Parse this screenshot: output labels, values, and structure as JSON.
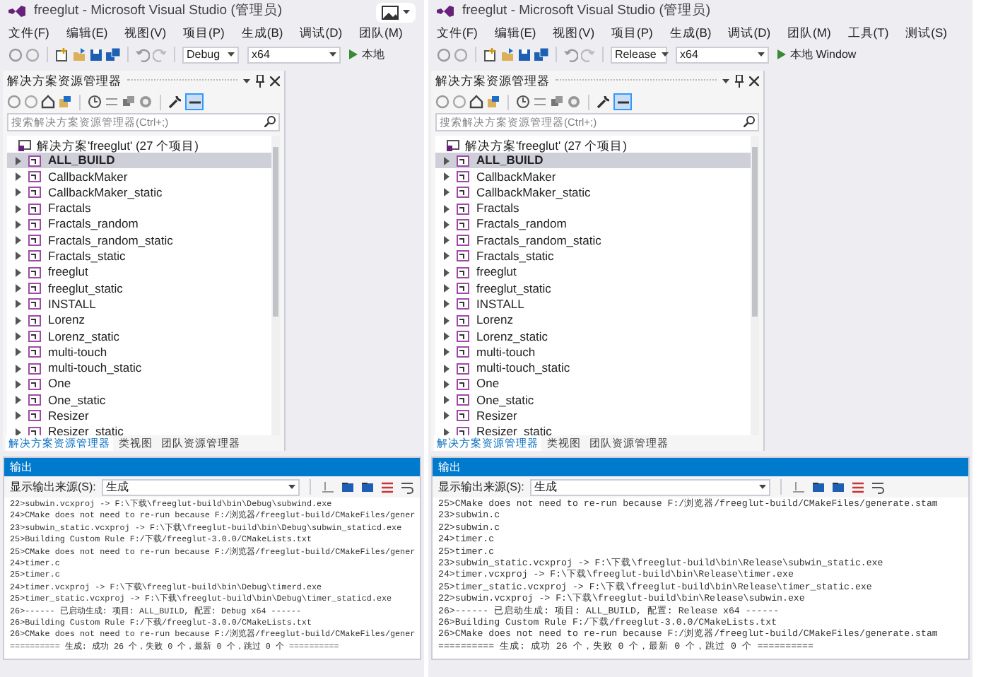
{
  "windows": [
    {
      "title": "freeglut - Microsoft Visual Studio (管理员)",
      "menu": [
        "文件(F)",
        "编辑(E)",
        "视图(V)",
        "项目(P)",
        "生成(B)",
        "调试(D)",
        "团队(M)"
      ],
      "toolbar": {
        "configuration": "Debug",
        "platform": "x64",
        "run_label": "本地"
      },
      "solution_explorer": {
        "title": "解决方案资源管理器",
        "search_placeholder": "搜索解决方案资源管理器(Ctrl+;)",
        "root": "解决方案'freeglut' (27 个项目)",
        "items": [
          {
            "label": "ALL_BUILD",
            "selected": true
          },
          {
            "label": "CallbackMaker",
            "selected": false
          },
          {
            "label": "CallbackMaker_static",
            "selected": false
          },
          {
            "label": "Fractals",
            "selected": false
          },
          {
            "label": "Fractals_random",
            "selected": false
          },
          {
            "label": "Fractals_random_static",
            "selected": false
          },
          {
            "label": "Fractals_static",
            "selected": false
          },
          {
            "label": "freeglut",
            "selected": false
          },
          {
            "label": "freeglut_static",
            "selected": false
          },
          {
            "label": "INSTALL",
            "selected": false
          },
          {
            "label": "Lorenz",
            "selected": false
          },
          {
            "label": "Lorenz_static",
            "selected": false
          },
          {
            "label": "multi-touch",
            "selected": false
          },
          {
            "label": "multi-touch_static",
            "selected": false
          },
          {
            "label": "One",
            "selected": false
          },
          {
            "label": "One_static",
            "selected": false
          },
          {
            "label": "Resizer",
            "selected": false
          },
          {
            "label": "Resizer_static",
            "selected": false
          }
        ],
        "tabs": [
          {
            "label": "解决方案资源管理器",
            "selected": true
          },
          {
            "label": "类视图",
            "selected": false
          },
          {
            "label": "团队资源管理器",
            "selected": false
          }
        ]
      },
      "output": {
        "title": "输出",
        "source_label": "显示输出来源(S):",
        "source_value": "生成",
        "lines": [
          "22>subwin.vcxproj -> F:\\下载\\freeglut-build\\bin\\Debug\\subwind.exe",
          "24>CMake does not need to re-run because F:/浏览器/freeglut-build/CMakeFiles/gener",
          "23>subwin_static.vcxproj -> F:\\下载\\freeglut-build\\bin\\Debug\\subwin_staticd.exe",
          "25>Building Custom Rule F:/下载/freeglut-3.0.0/CMakeLists.txt",
          "25>CMake does not need to re-run because F:/浏览器/freeglut-build/CMakeFiles/gener",
          "24>timer.c",
          "25>timer.c",
          "24>timer.vcxproj -> F:\\下载\\freeglut-build\\bin\\Debug\\timerd.exe",
          "25>timer_static.vcxproj -> F:\\下载\\freeglut-build\\bin\\Debug\\timer_staticd.exe",
          "26>------ 已启动生成: 项目: ALL_BUILD, 配置: Debug x64 ------",
          "26>Building Custom Rule F:/下载/freeglut-3.0.0/CMakeLists.txt",
          "26>CMake does not need to re-run because F:/浏览器/freeglut-build/CMakeFiles/gener",
          "========== 生成: 成功 26 个，失败 0 个，最新 0 个，跳过 0 个 =========="
        ]
      }
    },
    {
      "title": "freeglut - Microsoft Visual Studio (管理员)",
      "menu": [
        "文件(F)",
        "编辑(E)",
        "视图(V)",
        "项目(P)",
        "生成(B)",
        "调试(D)",
        "团队(M)",
        "工具(T)",
        "测试(S)"
      ],
      "toolbar": {
        "configuration": "Release",
        "platform": "x64",
        "run_label": "本地 Window"
      },
      "solution_explorer": {
        "title": "解决方案资源管理器",
        "search_placeholder": "搜索解决方案资源管理器(Ctrl+;)",
        "root": "解决方案'freeglut' (27 个项目)",
        "items": [
          {
            "label": "ALL_BUILD",
            "selected": true
          },
          {
            "label": "CallbackMaker",
            "selected": false
          },
          {
            "label": "CallbackMaker_static",
            "selected": false
          },
          {
            "label": "Fractals",
            "selected": false
          },
          {
            "label": "Fractals_random",
            "selected": false
          },
          {
            "label": "Fractals_random_static",
            "selected": false
          },
          {
            "label": "Fractals_static",
            "selected": false
          },
          {
            "label": "freeglut",
            "selected": false
          },
          {
            "label": "freeglut_static",
            "selected": false
          },
          {
            "label": "INSTALL",
            "selected": false
          },
          {
            "label": "Lorenz",
            "selected": false
          },
          {
            "label": "Lorenz_static",
            "selected": false
          },
          {
            "label": "multi-touch",
            "selected": false
          },
          {
            "label": "multi-touch_static",
            "selected": false
          },
          {
            "label": "One",
            "selected": false
          },
          {
            "label": "One_static",
            "selected": false
          },
          {
            "label": "Resizer",
            "selected": false
          },
          {
            "label": "Resizer_static",
            "selected": false
          }
        ],
        "tabs": [
          {
            "label": "解决方案资源管理器",
            "selected": true
          },
          {
            "label": "类视图",
            "selected": false
          },
          {
            "label": "团队资源管理器",
            "selected": false
          }
        ]
      },
      "output": {
        "title": "输出",
        "source_label": "显示输出来源(S):",
        "source_value": "生成",
        "lines": [
          "25>CMake does not need to re-run because F:/浏览器/freeglut-build/CMakeFiles/generate.stam",
          "23>subwin.c",
          "22>subwin.c",
          "24>timer.c",
          "25>timer.c",
          "23>subwin_static.vcxproj -> F:\\下载\\freeglut-build\\bin\\Release\\subwin_static.exe",
          "24>timer.vcxproj -> F:\\下载\\freeglut-build\\bin\\Release\\timer.exe",
          "25>timer_static.vcxproj -> F:\\下载\\freeglut-build\\bin\\Release\\timer_static.exe",
          "22>subwin.vcxproj -> F:\\下载\\freeglut-build\\bin\\Release\\subwin.exe",
          "26>------ 已启动生成: 项目: ALL_BUILD, 配置: Release x64 ------",
          "26>Building Custom Rule F:/下载/freeglut-3.0.0/CMakeLists.txt",
          "26>CMake does not need to re-run because F:/浏览器/freeglut-build/CMakeFiles/generate.stam",
          "========== 生成: 成功 26 个，失败 0 个，最新 0 个，跳过 0 个 =========="
        ]
      }
    }
  ]
}
